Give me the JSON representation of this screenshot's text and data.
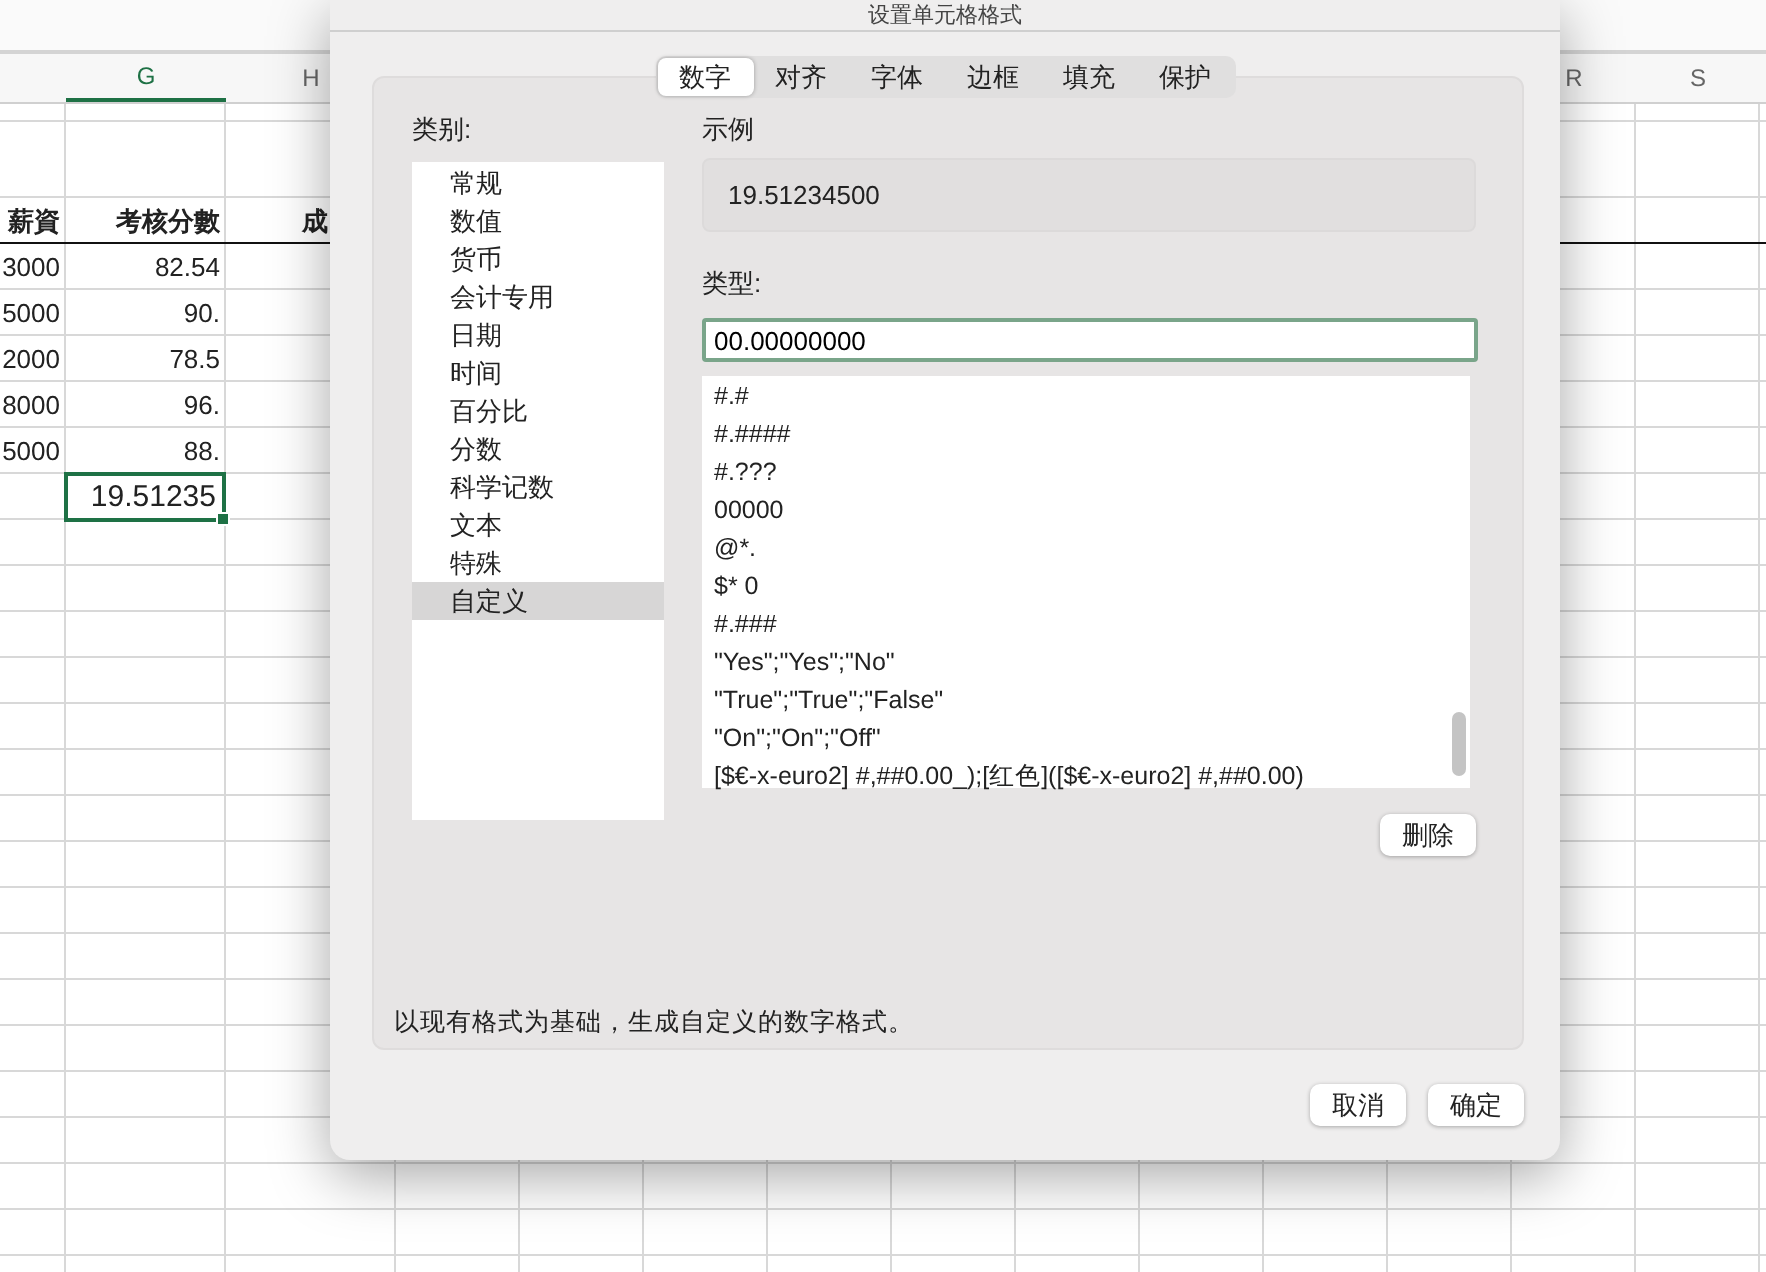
{
  "sheet": {
    "column_headers": [
      {
        "label": "G",
        "selected": true
      },
      {
        "label": "H",
        "selected": false
      },
      {
        "label": "R",
        "selected": false
      },
      {
        "label": "S",
        "selected": false
      }
    ],
    "rows": [
      {
        "kind": "header",
        "column_f": {
          "text": "薪資"
        },
        "column_g": {
          "text": "考核分數"
        },
        "column_h": {
          "text": "成"
        }
      },
      {
        "kind": "data",
        "column_f": {
          "text": "3000"
        },
        "column_g": {
          "text": "82.54"
        }
      },
      {
        "kind": "data",
        "column_f": {
          "text": "5000"
        },
        "column_g": {
          "text": "90."
        }
      },
      {
        "kind": "data",
        "column_f": {
          "text": "2000"
        },
        "column_g": {
          "text": "78.5"
        }
      },
      {
        "kind": "data",
        "column_f": {
          "text": "8000"
        },
        "column_g": {
          "text": "96."
        }
      },
      {
        "kind": "data",
        "column_f": {
          "text": "5000"
        },
        "column_g": {
          "text": "88."
        }
      },
      {
        "kind": "data",
        "column_g": {
          "text": "19.51235",
          "selected": true
        }
      }
    ]
  },
  "dialog": {
    "title": "设置单元格格式",
    "tabs": [
      {
        "label": "数字",
        "selected": true
      },
      {
        "label": "对齐",
        "selected": false
      },
      {
        "label": "字体",
        "selected": false
      },
      {
        "label": "边框",
        "selected": false
      },
      {
        "label": "填充",
        "selected": false
      },
      {
        "label": "保护",
        "selected": false
      }
    ],
    "category_label": "类别:",
    "categories": [
      {
        "label": "常规",
        "selected": false
      },
      {
        "label": "数值",
        "selected": false
      },
      {
        "label": "货币",
        "selected": false
      },
      {
        "label": "会计专用",
        "selected": false
      },
      {
        "label": "日期",
        "selected": false
      },
      {
        "label": "时间",
        "selected": false
      },
      {
        "label": "百分比",
        "selected": false
      },
      {
        "label": "分数",
        "selected": false
      },
      {
        "label": "科学记数",
        "selected": false
      },
      {
        "label": "文本",
        "selected": false
      },
      {
        "label": "特殊",
        "selected": false
      },
      {
        "label": "自定义",
        "selected": true
      }
    ],
    "sample_label": "示例",
    "sample_value": "19.51234500",
    "type_label": "类型:",
    "type_value": "00.00000000",
    "type_list": [
      "#.#",
      "#.####",
      "#.???",
      "00000",
      "@*.",
      "$* 0",
      "#.###",
      "\"Yes\";\"Yes\";\"No\"",
      "\"True\";\"True\";\"False\"",
      "\"On\";\"On\";\"Off\"",
      "[$€-x-euro2] #,##0.00_);[红色]([$€-x-euro2] #,##0.00)"
    ],
    "delete_button": "删除",
    "description": "以现有格式为基础，生成自定义的数字格式。",
    "buttons": [
      {
        "label": "取消"
      },
      {
        "label": "确定"
      }
    ]
  }
}
